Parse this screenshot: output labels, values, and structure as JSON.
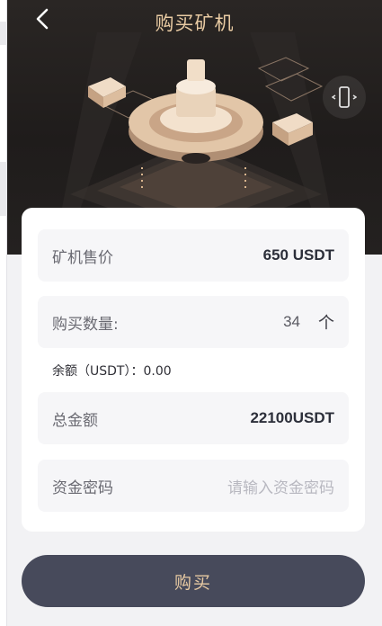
{
  "header": {
    "title": "购买矿机",
    "back_icon": "chevron-left-icon",
    "flip_icon": "phone-rotate-icon"
  },
  "form": {
    "price": {
      "label": "矿机售价",
      "value": "650 USDT"
    },
    "quantity": {
      "label": "购买数量:",
      "value": "34",
      "unit": "个"
    },
    "balance": "余额（USDT）：0.00",
    "total": {
      "label": "总金额",
      "value": "22100USDT"
    },
    "password": {
      "label": "资金密码",
      "placeholder": "请输入资金密码"
    }
  },
  "buy_label": "购买",
  "colors": {
    "accent_gold": "#e7c9a2",
    "button_bg": "#474a5b",
    "hero_bg": "#231f1e"
  }
}
